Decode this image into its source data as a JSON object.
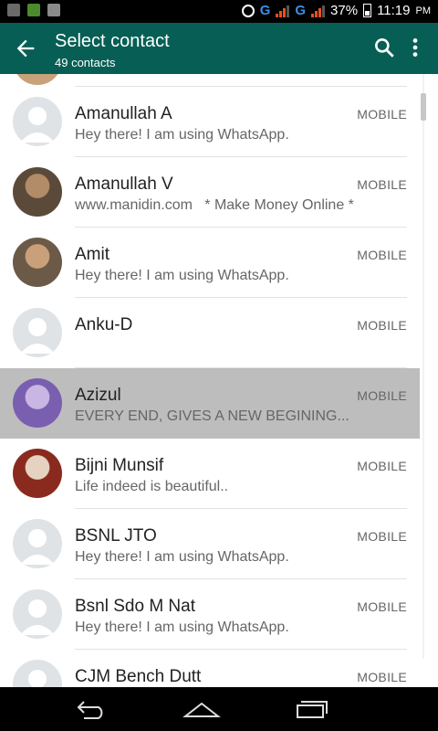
{
  "status_bar": {
    "network_1": "G",
    "network_2": "G",
    "battery": "37%",
    "time": "11:19",
    "ampm": "PM"
  },
  "app_bar": {
    "title": "Select contact",
    "subtitle": "49 contacts"
  },
  "contacts": [
    {
      "name": "Amanullah A",
      "status": "Hey there! I am using WhatsApp.",
      "tag": "MOBILE",
      "avatar": "default-avatar"
    },
    {
      "name": "Amanullah V",
      "status": "www.manidin.com   * Make Money Online *",
      "tag": "MOBILE",
      "avatar": "photo"
    },
    {
      "name": "Amit",
      "status": "Hey there! I am using WhatsApp.",
      "tag": "MOBILE",
      "avatar": "photo"
    },
    {
      "name": "Anku-D",
      "status": "",
      "tag": "MOBILE",
      "avatar": "default-avatar"
    },
    {
      "name": "Azizul",
      "status": "EVERY END, GIVES A NEW BEGINING...",
      "tag": "MOBILE",
      "avatar": "photo",
      "selected": true
    },
    {
      "name": "Bijni Munsif",
      "status": "Life indeed is beautiful..",
      "tag": "MOBILE",
      "avatar": "photo"
    },
    {
      "name": "BSNL JTO",
      "status": "Hey there! I am using WhatsApp.",
      "tag": "MOBILE",
      "avatar": "default-avatar"
    },
    {
      "name": "Bsnl Sdo M Nat",
      "status": "Hey there! I am using WhatsApp.",
      "tag": "MOBILE",
      "avatar": "default-avatar"
    },
    {
      "name": "CJM Bench Dutt",
      "status": "",
      "tag": "MOBILE",
      "avatar": "default-avatar"
    }
  ],
  "colors": {
    "app_bar": "#075e54",
    "selected_row": "#bdbdbd",
    "signal": "#e8501c",
    "network": "#3a8ee6"
  }
}
